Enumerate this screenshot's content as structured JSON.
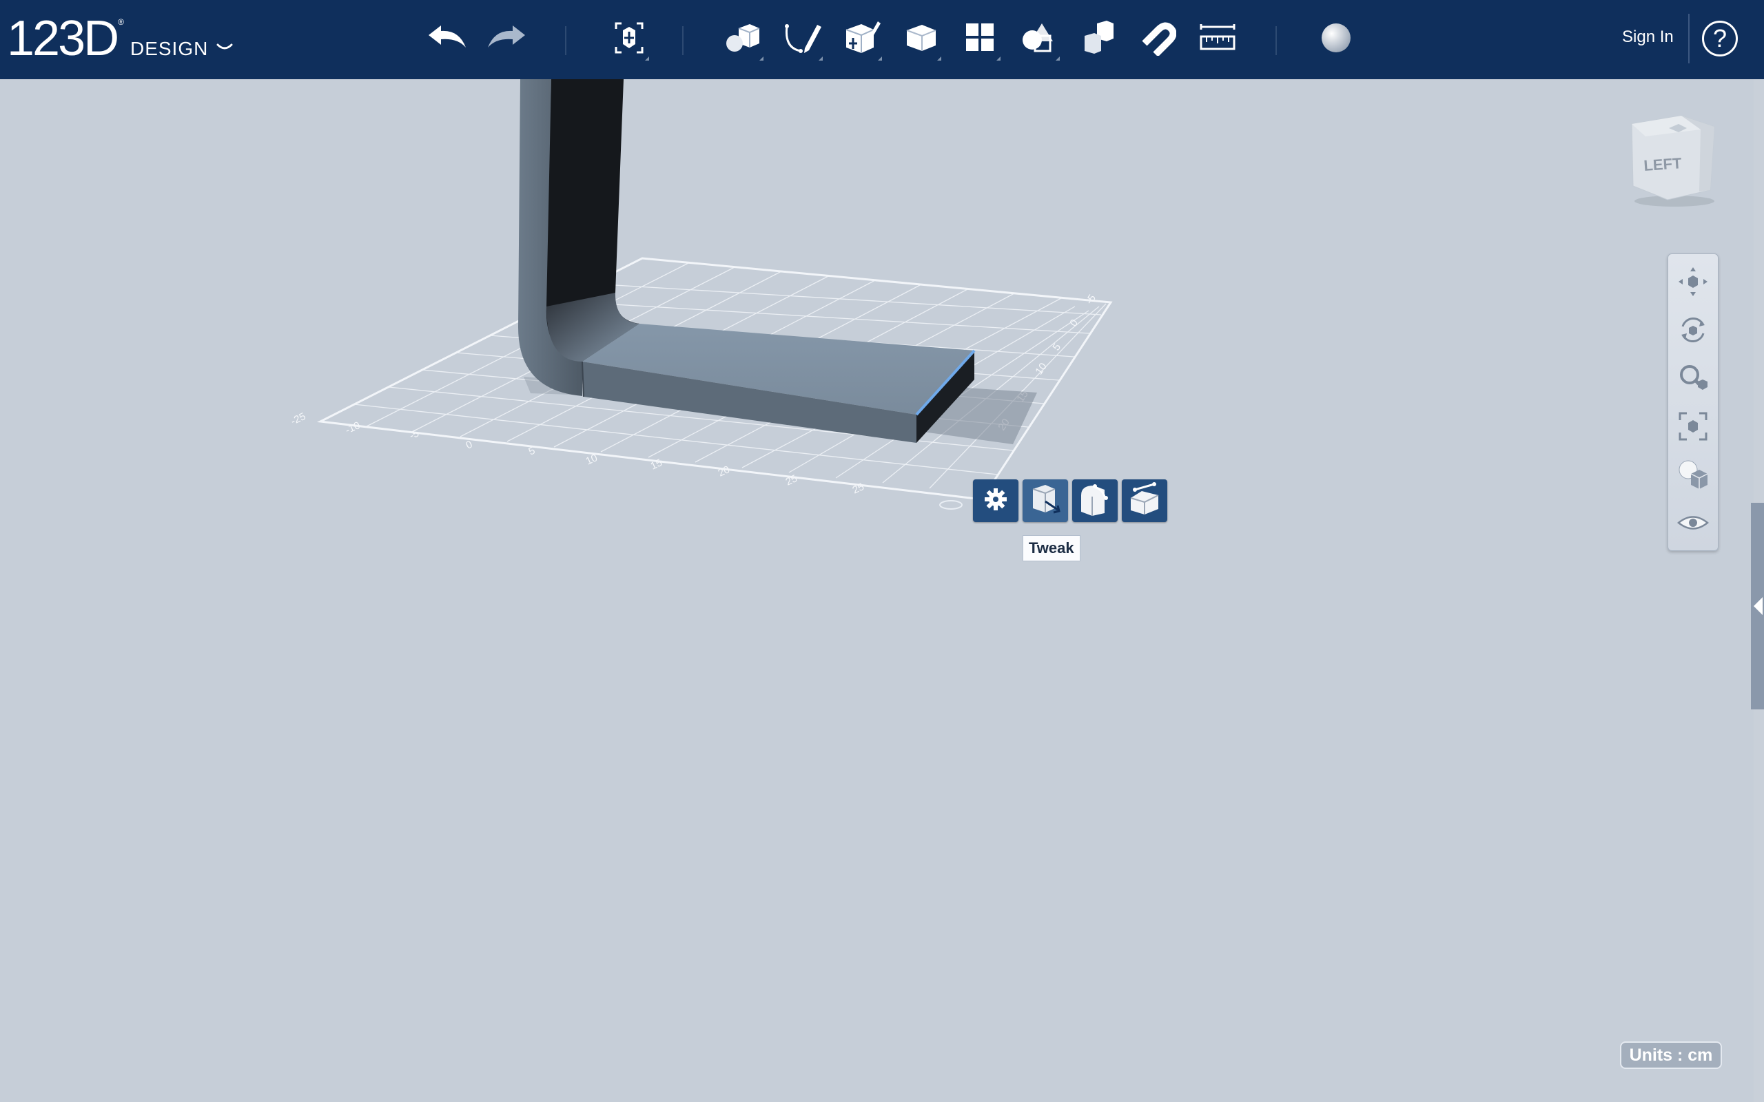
{
  "app": {
    "logo_number": "123D",
    "logo_word": "DESIGN",
    "logo_mark": "®"
  },
  "toolbar": {
    "items": [
      {
        "name": "undo-icon"
      },
      {
        "name": "redo-icon"
      },
      {
        "name": "transform-icon"
      },
      {
        "name": "primitives-icon"
      },
      {
        "name": "sketch-icon"
      },
      {
        "name": "construct-icon"
      },
      {
        "name": "modify-icon"
      },
      {
        "name": "pattern-icon"
      },
      {
        "name": "group-icon"
      },
      {
        "name": "combine-icon"
      },
      {
        "name": "snap-icon"
      },
      {
        "name": "measure-icon"
      },
      {
        "name": "material-icon"
      }
    ],
    "sign_in": "Sign In",
    "help": "?"
  },
  "viewport": {
    "context_menu": {
      "items": [
        {
          "name": "settings-icon"
        },
        {
          "name": "tweak-icon"
        },
        {
          "name": "fillet-icon"
        },
        {
          "name": "chamfer-icon"
        }
      ],
      "tooltip": "Tweak"
    },
    "view_cube": {
      "face_label": "LEFT"
    },
    "navigation": [
      {
        "name": "pan-icon"
      },
      {
        "name": "orbit-icon"
      },
      {
        "name": "zoom-icon"
      },
      {
        "name": "fit-icon"
      },
      {
        "name": "material-view-icon"
      },
      {
        "name": "visibility-icon"
      }
    ],
    "grid_labels": [
      "-25",
      "-10",
      "-5",
      "0",
      "5",
      "10",
      "15",
      "20",
      "25",
      "25",
      "20",
      "15",
      "10",
      "5",
      "0",
      "-5"
    ]
  },
  "status": {
    "units": "Units : cm"
  },
  "colors": {
    "toolbar_bg": "#0f2f5c",
    "viewport_bg": "#c6ced8",
    "selection_edge": "#6fa9ea",
    "context_button_bg": "#234d7e"
  }
}
